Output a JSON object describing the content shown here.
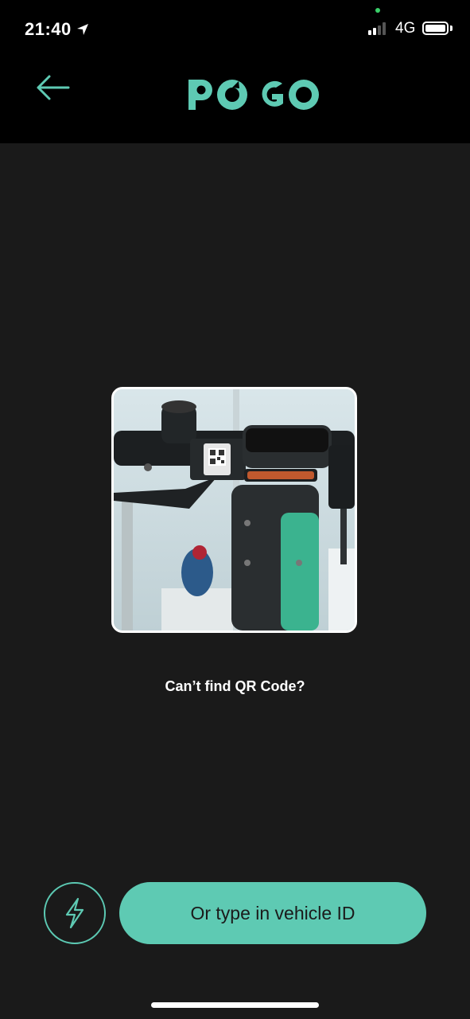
{
  "status_bar": {
    "time": "21:40",
    "network": "4G",
    "icons": [
      "location-arrow-icon",
      "signal-icon",
      "battery-icon"
    ]
  },
  "header": {
    "logo_text": "PDGO",
    "back_icon": "arrow-left-icon"
  },
  "scanner": {
    "help_text": "Can’t find QR Code?"
  },
  "actions": {
    "flash_icon": "lightning-icon",
    "vehicle_id_label": "Or type in vehicle ID"
  },
  "colors": {
    "accent": "#5ECAB3",
    "background": "#1A1A1A",
    "header": "#000000"
  }
}
